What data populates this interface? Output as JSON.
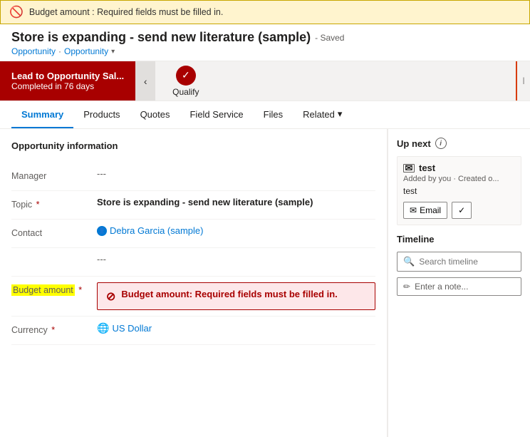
{
  "error_banner": {
    "text": "Budget amount : Required fields must be filled in."
  },
  "header": {
    "title": "Store is expanding - send new literature (sample)",
    "saved_label": "- Saved",
    "breadcrumb_entity": "Opportunity",
    "breadcrumb_type": "Opportunity"
  },
  "stage_bar": {
    "completed_stage": "Lead to Opportunity Sal...",
    "completed_days": "Completed in 76 days",
    "qualify_label": "Qualify"
  },
  "tabs": [
    {
      "id": "summary",
      "label": "Summary",
      "active": true
    },
    {
      "id": "products",
      "label": "Products",
      "active": false
    },
    {
      "id": "quotes",
      "label": "Quotes",
      "active": false
    },
    {
      "id": "field-service",
      "label": "Field Service",
      "active": false
    },
    {
      "id": "files",
      "label": "Files",
      "active": false
    },
    {
      "id": "related",
      "label": "Related",
      "active": false
    }
  ],
  "form": {
    "section_title": "Opportunity information",
    "fields": [
      {
        "id": "manager",
        "label": "Manager",
        "required": false,
        "value": "---",
        "type": "empty"
      },
      {
        "id": "topic",
        "label": "Topic",
        "required": true,
        "value": "Store is expanding - send new literature (sample)",
        "type": "bold"
      },
      {
        "id": "contact",
        "label": "Contact",
        "required": false,
        "value": "Debra Garcia (sample)",
        "type": "link"
      },
      {
        "id": "empty-row",
        "label": "",
        "required": false,
        "value": "---",
        "type": "empty"
      },
      {
        "id": "budget_amount",
        "label": "Budget amount",
        "required": true,
        "value": "",
        "type": "error",
        "error_text": "Budget amount: Required fields must be filled in."
      },
      {
        "id": "currency",
        "label": "Currency",
        "required": true,
        "value": "US Dollar",
        "type": "link"
      }
    ]
  },
  "right_panel": {
    "up_next_title": "Up next",
    "card": {
      "subject": "test",
      "meta": "Added by you · Created o...",
      "body": "test",
      "email_btn": "Email"
    },
    "timeline_title": "Timeline",
    "search_placeholder": "Search timeline",
    "note_placeholder": "Enter a note..."
  }
}
